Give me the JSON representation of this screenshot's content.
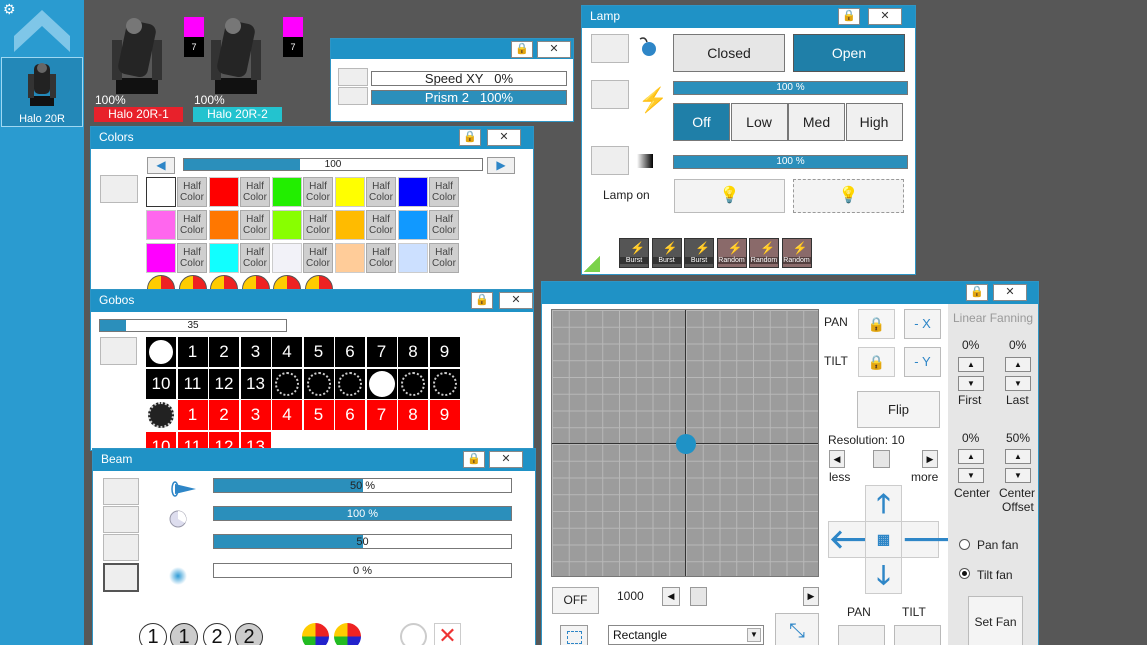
{
  "sidebar": {
    "fixture_label": "Halo 20R",
    "bg": "#2a9bd0"
  },
  "fixtures": [
    {
      "pct": "100%",
      "name": "Halo 20R-1",
      "badge": "7",
      "name_color": "#e8212b",
      "swatch": "#ff00ff"
    },
    {
      "pct": "100%",
      "name": "Halo 20R-2",
      "badge": "7",
      "name_color": "#23c3cf",
      "swatch": "#ff00ff"
    }
  ],
  "speed_panel": {
    "rows": [
      {
        "label": "Speed XY",
        "value": "0%",
        "level": 0
      },
      {
        "label": "Prism 2",
        "value": "100%",
        "level": 1
      }
    ]
  },
  "colors": {
    "title": "Colors",
    "slider_value": "100",
    "slider_level": 0.45,
    "half_label_1": "Half",
    "half_label_2": "Color",
    "swatches": [
      "#ffffff",
      "#ff0000",
      "#22ee00",
      "#ffff00",
      "#0000ff",
      "#ff66ee",
      "#ff7700",
      "#88ff00",
      "#ffbb00",
      "#1199ff",
      "#ff00ff",
      "#11ffff",
      "#f2f2f8",
      "#ffcc99",
      "#cce0ff"
    ]
  },
  "gobos": {
    "title": "Gobos",
    "slider_value": "35",
    "slider_level": 0.14,
    "row1": [
      "1",
      "2",
      "3",
      "4",
      "5",
      "6",
      "7",
      "8",
      "9"
    ],
    "row2": [
      "10",
      "11",
      "12",
      "13"
    ],
    "row3": [
      "1",
      "2",
      "3",
      "4",
      "5",
      "6",
      "7",
      "8",
      "9"
    ],
    "row4": [
      "10",
      "11",
      "12",
      "13"
    ]
  },
  "beam": {
    "title": "Beam",
    "bars": [
      {
        "text": "50 %",
        "level": 0.5
      },
      {
        "text": "100 %",
        "level": 1
      },
      {
        "text": "50",
        "level": 0.5
      },
      {
        "text": "0 %",
        "level": 0
      }
    ],
    "bottom_nums": [
      "1",
      "1",
      "2",
      "2"
    ]
  },
  "lamp": {
    "title": "Lamp",
    "closed_label": "Closed",
    "open_label": "Open",
    "bar1_text": "100 %",
    "bar2_text": "100 %",
    "power_buttons": [
      "Off",
      "Low",
      "Med",
      "High"
    ],
    "lamp_on_label": "Lamp on",
    "effects": [
      "Burst",
      "Burst",
      "Burst",
      "Random",
      "Random",
      "Random"
    ]
  },
  "pantilt": {
    "pan_label": "PAN",
    "tilt_label": "TILT",
    "minus_x_label": "- X",
    "minus_y_label": "- Y",
    "flip_label": "Flip",
    "resolution_label": "Resolution: 10",
    "less_label": "less",
    "more_label": "more",
    "off_label": "OFF",
    "speed_value": "1000",
    "shape_value": "Rectangle",
    "pan_bottom": "PAN",
    "tilt_bottom": "TILT",
    "fanning_title": "Linear Fanning",
    "first_pct": "0%",
    "last_pct": "0%",
    "first_label": "First",
    "last_label": "Last",
    "center_pct": "0%",
    "center_offset_pct": "50%",
    "center_label": "Center",
    "center_offset_label_1": "Center",
    "center_offset_label_2": "Offset",
    "pan_fan_label": "Pan fan",
    "tilt_fan_label": "Tilt fan",
    "set_fan_label": "Set Fan"
  }
}
